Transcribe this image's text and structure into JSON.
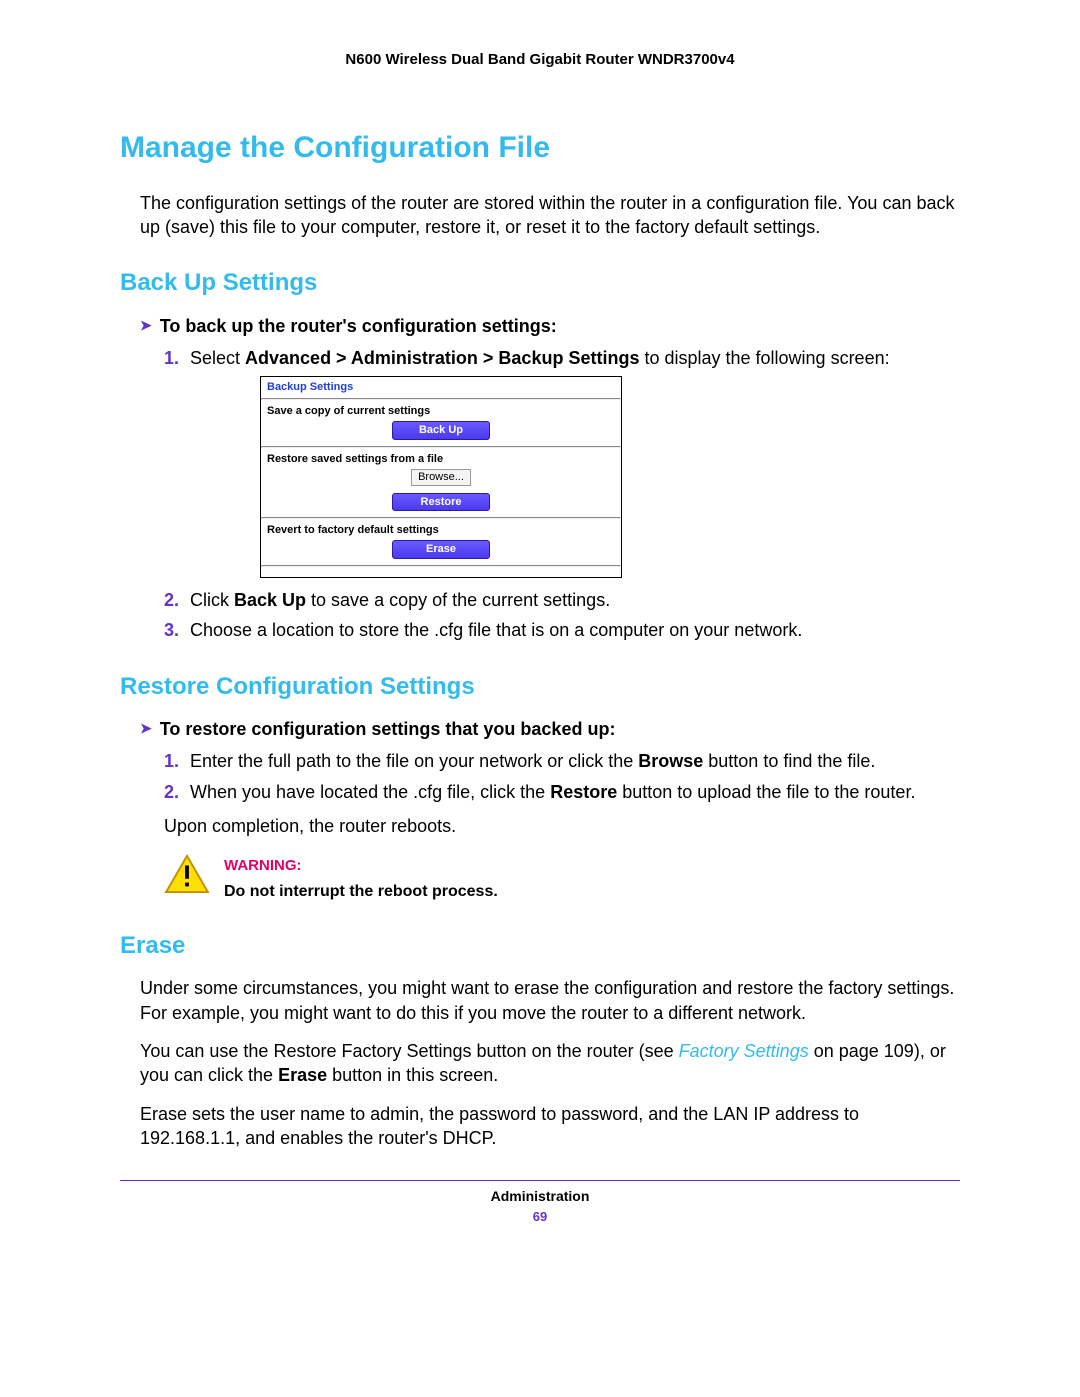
{
  "header": {
    "product": "N600 Wireless Dual Band Gigabit Router WNDR3700v4"
  },
  "h1": "Manage the Configuration File",
  "intro": "The configuration settings of the router are stored within the router in a configuration file. You can back up (save) this file to your computer, restore it, or reset it to the factory default settings.",
  "backup": {
    "heading": "Back Up Settings",
    "lead": "To back up the router's configuration settings:",
    "step1_a": "Select ",
    "step1_b": "Advanced > Administration > Backup Settings",
    "step1_c": " to display the following screen:",
    "step2_a": "Click ",
    "step2_b": "Back Up",
    "step2_c": " to save a copy of the current settings.",
    "step3": "Choose a location to store the .cfg file that is on a computer on your network."
  },
  "panel": {
    "title": "Backup Settings",
    "row1": "Save a copy of current settings",
    "btn_backup": "Back Up",
    "row2": "Restore saved settings from a file",
    "btn_browse": "Browse...",
    "btn_restore": "Restore",
    "row3": "Revert to factory default settings",
    "btn_erase": "Erase"
  },
  "restore": {
    "heading": "Restore Configuration Settings",
    "lead": "To restore configuration settings that you backed up:",
    "step1_a": "Enter the full path to the file on your network or click the ",
    "step1_b": "Browse",
    "step1_c": " button to find the file.",
    "step2_a": "When you have located the .cfg file, click the ",
    "step2_b": "Restore",
    "step2_c": " button to upload the file to the router.",
    "upon": "Upon completion, the router reboots."
  },
  "warning": {
    "label": "WARNING:",
    "body": "Do not interrupt the reboot process."
  },
  "erase": {
    "heading": "Erase",
    "p1": "Under some circumstances, you might want to erase the configuration and restore the factory settings. For example, you might want to do this if you move the router to a different network.",
    "p2_a": "You can use the Restore Factory Settings button on the router (see ",
    "p2_link": "Factory Settings",
    "p2_b": " on page 109), or you can click the ",
    "p2_bold": "Erase",
    "p2_c": " button in this screen.",
    "p3": "Erase sets the user name to admin, the password to password, and the LAN IP address to 192.168.1.1, and enables the router's DHCP."
  },
  "footer": {
    "section": "Administration",
    "page": "69"
  }
}
